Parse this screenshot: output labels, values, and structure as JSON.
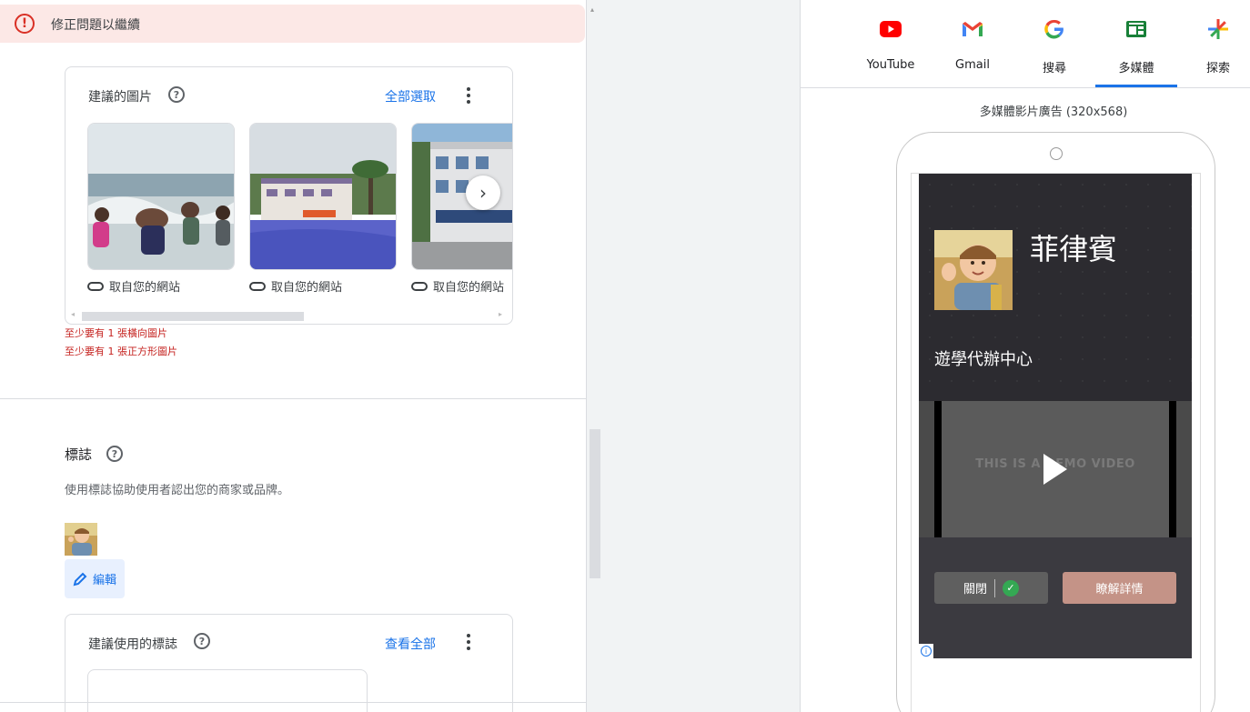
{
  "error_banner": {
    "text": "修正問題以繼續",
    "icon": "error-icon"
  },
  "suggested_images": {
    "title": "建議的圖片",
    "select_all": "全部選取",
    "items": [
      {
        "caption": "取自您的網站",
        "scene": "beach-children"
      },
      {
        "caption": "取自您的網站",
        "scene": "resort-pool"
      },
      {
        "caption": "取自您的網站",
        "scene": "school-building"
      }
    ],
    "errors": [
      "至少要有 1 張橫向圖片",
      "至少要有 1 張正方形圖片"
    ]
  },
  "logo_section": {
    "title": "標誌",
    "description": "使用標誌協助使用者認出您的商家或品牌。",
    "edit_label": "編輯"
  },
  "suggested_logos": {
    "title": "建議使用的標誌",
    "view_all": "查看全部"
  },
  "preview_tabs": [
    {
      "label": "YouTube",
      "icon": "youtube-icon",
      "active": false
    },
    {
      "label": "Gmail",
      "icon": "gmail-icon",
      "active": false
    },
    {
      "label": "搜尋",
      "icon": "google-search-icon",
      "active": false
    },
    {
      "label": "多媒體",
      "icon": "display-icon",
      "active": true
    },
    {
      "label": "探索",
      "icon": "discover-icon",
      "active": false
    }
  ],
  "preview": {
    "title": "多媒體影片廣告 (320x568)",
    "ad_headline": "菲律賓",
    "ad_subline": "遊學代辦中心",
    "video_text": "THIS IS A DEMO VIDEO",
    "close_label": "關閉",
    "learn_more_label": "瞭解詳情"
  },
  "colors": {
    "accent": "#1a73e8",
    "error": "#d93025",
    "cta": "#c49387"
  }
}
